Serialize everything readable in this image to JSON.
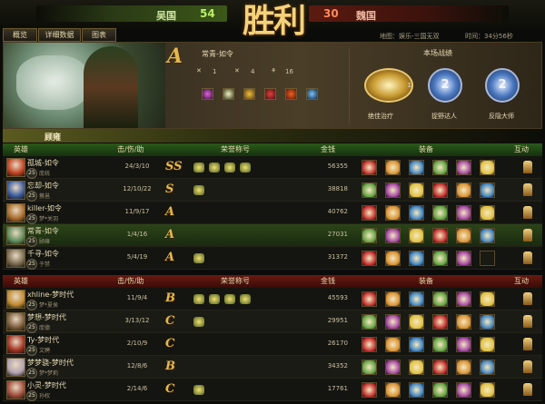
{
  "header": {
    "team_left": {
      "name": "吴国",
      "score": "54",
      "color": "#8ec93c"
    },
    "team_right": {
      "score": "30",
      "name": "魏国",
      "color": "#e04a2c"
    },
    "result": "胜利"
  },
  "tabs": [
    {
      "label": "概览"
    },
    {
      "label": "详细数据"
    },
    {
      "label": "图表"
    }
  ],
  "match_info": {
    "map": "地图：娱乐-三国无双",
    "time": "时间：34分56秒"
  },
  "summary": {
    "player": "常青-如令",
    "grade": "A",
    "stats": [
      {
        "icon": "kill-icon",
        "value": "1"
      },
      {
        "icon": "death-icon",
        "value": "4"
      },
      {
        "icon": "assist-icon",
        "value": "16"
      }
    ],
    "honors_title": "本场战绩",
    "honors": [
      {
        "label": "绝佳治疗",
        "badge": "1",
        "style": "gold"
      },
      {
        "label": "捉野达人",
        "badge": "2",
        "style": "blue"
      },
      {
        "label": "反隐大师",
        "badge": "2",
        "style": "blue"
      }
    ]
  },
  "section_label": "顾雍",
  "columns": {
    "hero": "英雄",
    "kda": "击/伤/助",
    "honor": "荣誉称号",
    "gold": "金钱",
    "equip": "装备",
    "interact": "互动"
  },
  "team_a": [
    {
      "player": "孤城-如令",
      "hero": "庞统",
      "level": "25",
      "kda": "24/3/10",
      "grade": "SS",
      "gold": "56355",
      "color": "#c04020"
    },
    {
      "player": "忘却-如令",
      "hero": "蔡邕",
      "level": "25",
      "kda": "12/10/22",
      "grade": "S",
      "gold": "38818",
      "color": "#3a5aa0"
    },
    {
      "player": "killer-如令",
      "hero": "梦*关羽",
      "level": "25",
      "kda": "11/9/17",
      "grade": "A",
      "gold": "40762",
      "color": "#a86a2a"
    },
    {
      "player": "常青-如令",
      "hero": "顾雍",
      "level": "25",
      "kda": "1/4/16",
      "grade": "A",
      "gold": "27031",
      "color": "#5a8a5a"
    },
    {
      "player": "千寻-如令",
      "hero": "于禁",
      "level": "25",
      "kda": "5/4/19",
      "grade": "A",
      "gold": "31372",
      "color": "#7a6a50"
    }
  ],
  "team_b": [
    {
      "player": "xhline-梦时代",
      "hero": "梦*夏侯",
      "level": "25",
      "kda": "11/9/4",
      "grade": "B",
      "gold": "45593",
      "color": "#c08a30"
    },
    {
      "player": "梦想-梦时代",
      "hero": "庞德",
      "level": "25",
      "kda": "3/13/12",
      "grade": "C",
      "gold": "29951",
      "color": "#7a5a3a"
    },
    {
      "player": "Ty-梦时代",
      "hero": "文聘",
      "level": "25",
      "kda": "2/10/9",
      "grade": "C",
      "gold": "26170",
      "color": "#a03020"
    },
    {
      "player": "梦梦骁-梦时代",
      "hero": "梦*梦莉",
      "level": "25",
      "kda": "12/8/6",
      "grade": "B",
      "gold": "34352",
      "color": "#b0a0b0"
    },
    {
      "player": "小灵-梦时代",
      "hero": "孙权",
      "level": "25",
      "kda": "2/14/6",
      "grade": "C",
      "gold": "17761",
      "color": "#a04a3a"
    }
  ]
}
